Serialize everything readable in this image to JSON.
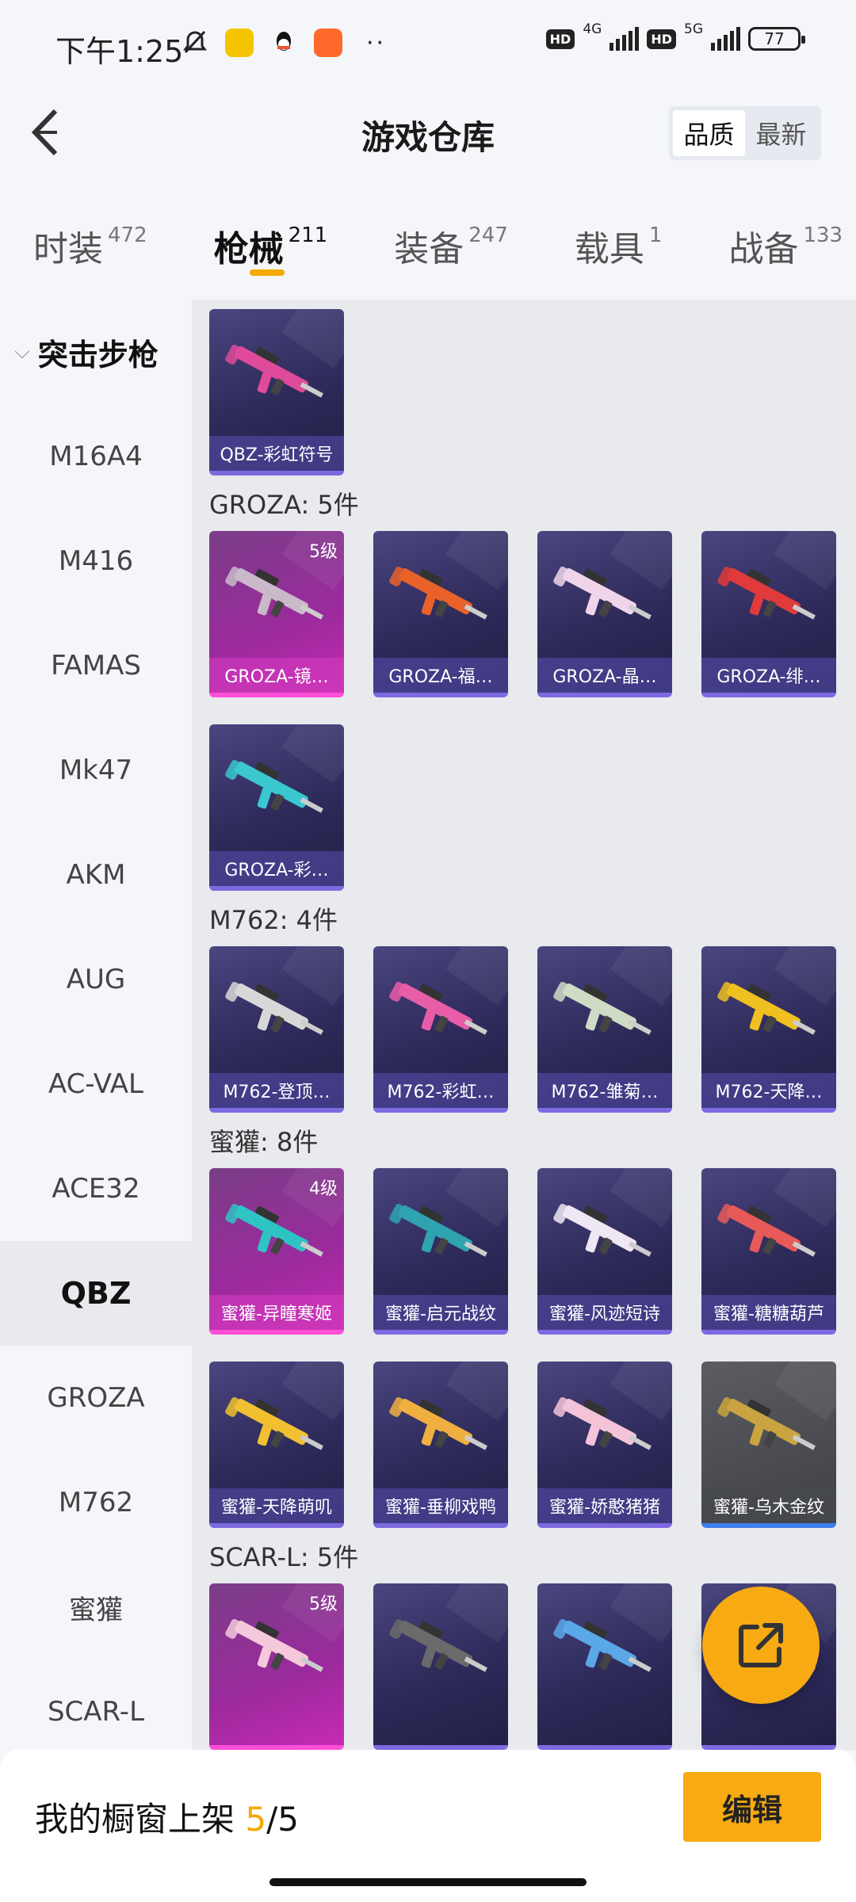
{
  "status_bar": {
    "time": "下午1:25",
    "network_1": "4G",
    "network_2": "5G",
    "hd": "HD",
    "battery": "77",
    "more": "··"
  },
  "header": {
    "title": "游戏仓库",
    "sort_options": [
      "品质",
      "最新"
    ],
    "active_sort": "品质"
  },
  "category_tabs": [
    {
      "label": "时装",
      "count": "472"
    },
    {
      "label": "枪械",
      "count": "211"
    },
    {
      "label": "装备",
      "count": "247"
    },
    {
      "label": "载具",
      "count": "1"
    },
    {
      "label": "战备",
      "count": "133"
    }
  ],
  "sidebar": {
    "group": "突击步枪",
    "items": [
      "M16A4",
      "M416",
      "FAMAS",
      "Mk47",
      "AKM",
      "AUG",
      "AC-VAL",
      "ACE32",
      "QBZ",
      "GROZA",
      "M762",
      "蜜獾",
      "SCAR-L"
    ],
    "active": "QBZ"
  },
  "sections": {
    "qbz": {
      "cards": [
        {
          "name": "QBZ-彩虹符号",
          "style": "purple",
          "gun_color": "#e04a9a"
        }
      ]
    },
    "groza": {
      "title": "GROZA: 5件",
      "cards": [
        {
          "name": "GROZA-镜…",
          "level": "5级",
          "style": "pink",
          "gun_color": "#c9b9c9"
        },
        {
          "name": "GROZA-福…",
          "style": "purple",
          "gun_color": "#e8622a"
        },
        {
          "name": "GROZA-晶…",
          "style": "purple",
          "gun_color": "#f0d5ea"
        },
        {
          "name": "GROZA-绯…",
          "style": "purple",
          "gun_color": "#e03a3a"
        },
        {
          "name": "GROZA-彩…",
          "style": "purple",
          "gun_color": "#3ac7d0"
        }
      ]
    },
    "m762": {
      "title": "M762: 4件",
      "cards": [
        {
          "name": "M762-登顶…",
          "style": "purple",
          "gun_color": "#d8d8d8"
        },
        {
          "name": "M762-彩虹…",
          "style": "purple",
          "gun_color": "#e75da8"
        },
        {
          "name": "M762-雏菊…",
          "style": "purple",
          "gun_color": "#cfdcc5"
        },
        {
          "name": "M762-天降…",
          "style": "purple",
          "gun_color": "#f0c020"
        }
      ]
    },
    "honeybadger": {
      "title": "蜜獾: 8件",
      "cards": [
        {
          "name": "蜜獾-异瞳寒姬",
          "level": "4级",
          "style": "pink",
          "gun_color": "#2ec4c4"
        },
        {
          "name": "蜜獾-启元战纹",
          "style": "purple",
          "gun_color": "#2fa3b0"
        },
        {
          "name": "蜜獾-风迹短诗",
          "style": "purple",
          "gun_color": "#f0e7f5"
        },
        {
          "name": "蜜獾-糖糖葫芦",
          "style": "purple",
          "gun_color": "#e85a5a"
        },
        {
          "name": "蜜獾-天降萌叽",
          "style": "purple",
          "gun_color": "#f0c030"
        },
        {
          "name": "蜜獾-垂柳戏鸭",
          "style": "purple",
          "gun_color": "#f0b040"
        },
        {
          "name": "蜜獾-娇憨猪猪",
          "style": "purple",
          "gun_color": "#f5c3d8"
        },
        {
          "name": "蜜獾-乌木金纹",
          "style": "gray",
          "gun_color": "#c9a440"
        }
      ]
    },
    "scarl": {
      "title": "SCAR-L: 5件",
      "cards": [
        {
          "name": "",
          "level": "5级",
          "style": "pink",
          "gun_color": "#f5c8dc"
        },
        {
          "name": "",
          "style": "purple",
          "gun_color": "#6a6a6a"
        },
        {
          "name": "",
          "style": "purple",
          "gun_color": "#5aa8e8"
        },
        {
          "name": "",
          "style": "purple",
          "gun_color": "#e0a030"
        }
      ]
    }
  },
  "bottom_bar": {
    "label": "我的橱窗上架",
    "current": "5",
    "total": "/5",
    "edit_button": "编辑"
  },
  "colors": {
    "accent": "#f7aa12",
    "card_purple": "#2e2a5a",
    "card_pink": "#c62bb3"
  }
}
